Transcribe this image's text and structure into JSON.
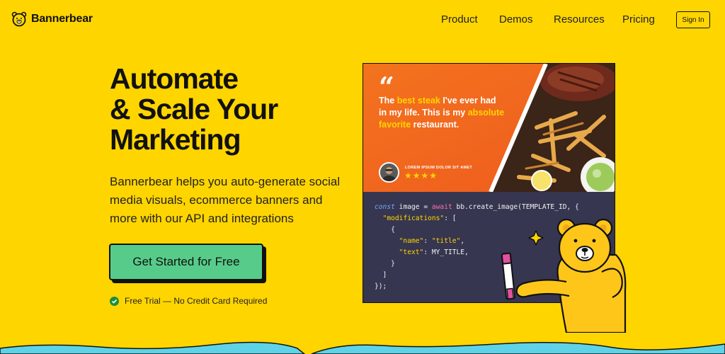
{
  "nav": {
    "brand": "Bannerbear",
    "links": [
      "Product",
      "Demos",
      "Resources",
      "Pricing"
    ],
    "signin": "Sign In"
  },
  "hero": {
    "headline": [
      "Automate",
      "& Scale Your",
      "Marketing"
    ],
    "subtext": "Bannerbear helps you auto-generate social media visuals, ecommerce banners and more with our API and integrations",
    "cta": "Get Started for Free",
    "trial": "Free Trial — No Credit Card Required"
  },
  "banner": {
    "quote_mark": "“",
    "quote_parts": [
      "The ",
      "best steak",
      " I've ever had in my life. This is my ",
      "absolute favorite",
      " restaurant."
    ],
    "reviewer": "LOREM IPSUM DOLOR SIT AMET",
    "stars": "★★★★"
  },
  "code": {
    "l1a": "const",
    "l1b": " image = ",
    "l1c": "await",
    "l1d": " bb.create_image(TEMPLATE_ID, {",
    "l2a": "  ",
    "l2b": "\"modifications\"",
    "l2c": ": [",
    "l3": "    {",
    "l4a": "      ",
    "l4b": "\"name\"",
    "l4c": ": ",
    "l4d": "\"title\"",
    "l4e": ",",
    "l5a": "      ",
    "l5b": "\"text\"",
    "l5c": ": MY_TITLE,",
    "l6": "    }",
    "l7": "  ]",
    "l8": "});"
  },
  "colors": {
    "background": "#FFD500",
    "cta": "#57CC8A",
    "banner_orange": "#F2661E",
    "code_bg": "#363650",
    "mascot": "#FFC61A",
    "water": "#5ED3E8"
  }
}
